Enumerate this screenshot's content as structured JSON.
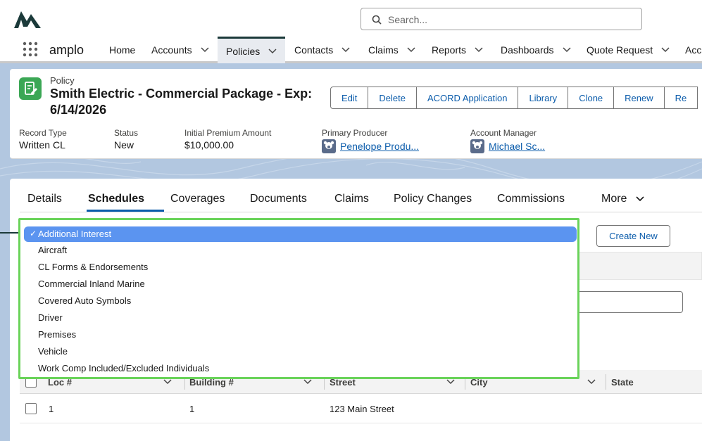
{
  "header": {
    "search_placeholder": "Search...",
    "app_name": "amplo"
  },
  "nav": {
    "items": [
      {
        "label": "Home",
        "has_menu": false
      },
      {
        "label": "Accounts",
        "has_menu": true
      },
      {
        "label": "Policies",
        "has_menu": true,
        "active": true
      },
      {
        "label": "Contacts",
        "has_menu": true
      },
      {
        "label": "Claims",
        "has_menu": true
      },
      {
        "label": "Reports",
        "has_menu": true
      },
      {
        "label": "Dashboards",
        "has_menu": true
      },
      {
        "label": "Quote Request",
        "has_menu": true
      },
      {
        "label": "Acc",
        "has_menu": false
      }
    ]
  },
  "record": {
    "object_type": "Policy",
    "title": "Smith Electric - Commercial Package - Exp: 6/14/2026",
    "actions": [
      "Edit",
      "Delete",
      "ACORD Application",
      "Library",
      "Clone",
      "Renew",
      "Re"
    ],
    "fields": {
      "record_type": {
        "label": "Record Type",
        "value": "Written CL"
      },
      "status": {
        "label": "Status",
        "value": "New"
      },
      "premium": {
        "label": "Initial Premium Amount",
        "value": "$10,000.00"
      },
      "producer": {
        "label": "Primary Producer",
        "value": "Penelope Produ..."
      },
      "manager": {
        "label": "Account Manager",
        "value": "Michael Sc..."
      }
    }
  },
  "tabs": {
    "items": [
      "Details",
      "Schedules",
      "Coverages",
      "Documents",
      "Claims",
      "Policy Changes",
      "Commissions",
      "More"
    ],
    "active": "Schedules"
  },
  "schedules": {
    "create_label": "Create New",
    "dropdown": {
      "selected": "Additional Interest",
      "options": [
        "Aircraft",
        "CL Forms & Endorsements",
        "Commercial Inland Marine",
        "Covered Auto Symbols",
        "Driver",
        "Premises",
        "Vehicle",
        "Work Comp Included/Excluded Individuals"
      ]
    },
    "table": {
      "columns": [
        "Loc #",
        "Building #",
        "Street",
        "City",
        "State"
      ],
      "rows": [
        {
          "loc": "1",
          "building": "1",
          "street": "123 Main Street",
          "city": "",
          "state": ""
        }
      ]
    }
  },
  "colors": {
    "accent": "#0b5cab",
    "highlight": "#6ad35a",
    "selected": "#5b94f0",
    "policy_icon": "#3ba755"
  }
}
